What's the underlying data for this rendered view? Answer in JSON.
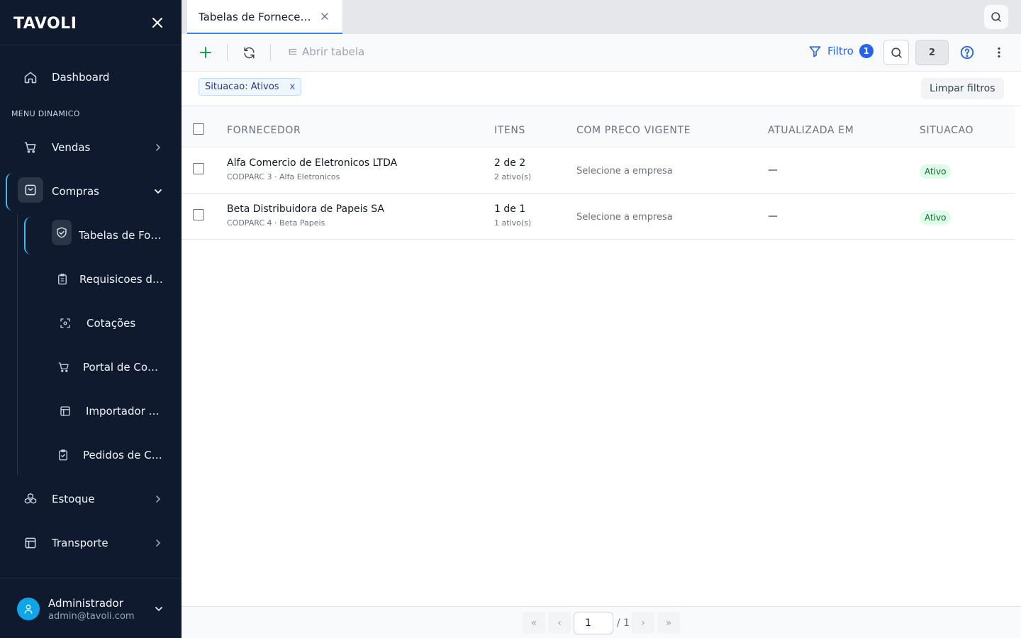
{
  "brand": {
    "logo_text": "TAVOLI"
  },
  "sidebar": {
    "dashboard": "Dashboard",
    "section_title": "MENU DINAMICO",
    "items": [
      {
        "label": "Vendas",
        "icon": "cart-icon"
      },
      {
        "label": "Compras",
        "icon": "shopping-bag-icon",
        "expanded": true
      },
      {
        "label": "Estoque",
        "icon": "boxes-icon"
      },
      {
        "label": "Transporte",
        "icon": "layout-icon"
      }
    ],
    "compras_sub": [
      {
        "label": "Tabelas de Fornecedores",
        "icon": "handshake-icon",
        "active": true
      },
      {
        "label": "Requisicoes de Compra",
        "icon": "clipboard-icon"
      },
      {
        "label": "Cotações",
        "icon": "scan-icon"
      },
      {
        "label": "Portal de Compras",
        "icon": "cart-icon"
      },
      {
        "label": "Importador XML",
        "icon": "layout-icon"
      },
      {
        "label": "Pedidos de Compra",
        "icon": "clipboard-check-icon"
      }
    ],
    "user": {
      "name": "Administrador",
      "email": "admin@tavoli.com"
    }
  },
  "tabs": [
    {
      "label": "Tabelas de Fornecedores",
      "active": true
    }
  ],
  "toolbar": {
    "open_table": "Abrir tabela",
    "filter_label": "Filtro",
    "filter_count": "1",
    "result_count": "2"
  },
  "filters": {
    "chips": [
      {
        "label": "Situacao: Ativos",
        "remove": "x"
      }
    ],
    "clear_label": "Limpar filtros"
  },
  "table": {
    "columns": [
      "FORNECEDOR",
      "ITENS",
      "COM PRECO VIGENTE",
      "ATUALIZADA EM",
      "SITUACAO"
    ],
    "rows": [
      {
        "name": "Alfa Comercio de Eletronicos LTDA",
        "sub": "CODPARC 3 · Alfa Eletronicos",
        "items": "2 de 2",
        "items_sub": "2 ativo(s)",
        "preco": "Selecione a empresa",
        "updated": "—",
        "status": "Ativo"
      },
      {
        "name": "Beta Distribuidora de Papeis SA",
        "sub": "CODPARC 4 · Beta Papeis",
        "items": "1 de 1",
        "items_sub": "1 ativo(s)",
        "preco": "Selecione a empresa",
        "updated": "—",
        "status": "Ativo"
      }
    ]
  },
  "pagination": {
    "first": "«",
    "prev": "‹",
    "current": "1",
    "total": "/ 1",
    "next": "›",
    "last": "»"
  },
  "colors": {
    "sidebar_bg": "#0f1a2e",
    "accent": "#38bdf8",
    "primary": "#2563eb",
    "success_bg": "#dcfce7",
    "success_text": "#166534"
  }
}
